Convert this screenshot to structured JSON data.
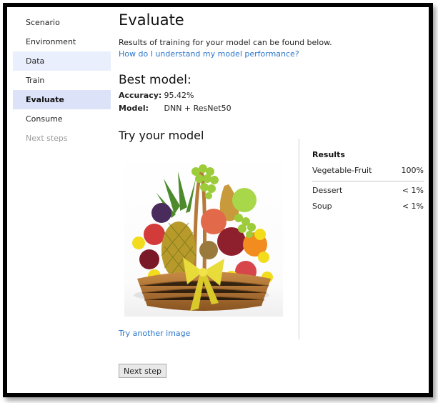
{
  "sidebar": {
    "items": [
      {
        "label": "Scenario",
        "state": "normal"
      },
      {
        "label": "Environment",
        "state": "normal"
      },
      {
        "label": "Data",
        "state": "visited"
      },
      {
        "label": "Train",
        "state": "normal"
      },
      {
        "label": "Evaluate",
        "state": "active"
      },
      {
        "label": "Consume",
        "state": "normal"
      },
      {
        "label": "Next steps",
        "state": "disabled"
      }
    ]
  },
  "main": {
    "title": "Evaluate",
    "subtitle": "Results of training for your model can be found below.",
    "help_link": "How do I understand my model performance?",
    "best_model": {
      "title": "Best model:",
      "accuracy_label": "Accuracy:",
      "accuracy_value": "95.42%",
      "model_label": "Model:",
      "model_value": "DNN + ResNet50"
    },
    "try_model": {
      "title": "Try your model",
      "image_alt": "Fruit basket with pineapple, grapes, apples, pear, orange and yellow bow",
      "try_another_link": "Try another image"
    },
    "results": {
      "title": "Results",
      "top": {
        "label": "Vegetable-Fruit",
        "value": "100%"
      },
      "others": [
        {
          "label": "Dessert",
          "value": "< 1%"
        },
        {
          "label": "Soup",
          "value": "< 1%"
        }
      ]
    },
    "next_button": "Next step"
  },
  "colors": {
    "link": "#2a75c9",
    "nav_active_bg": "#dce2f7",
    "nav_visited_bg": "#e9effc",
    "disabled_text": "#9b9b9b"
  }
}
